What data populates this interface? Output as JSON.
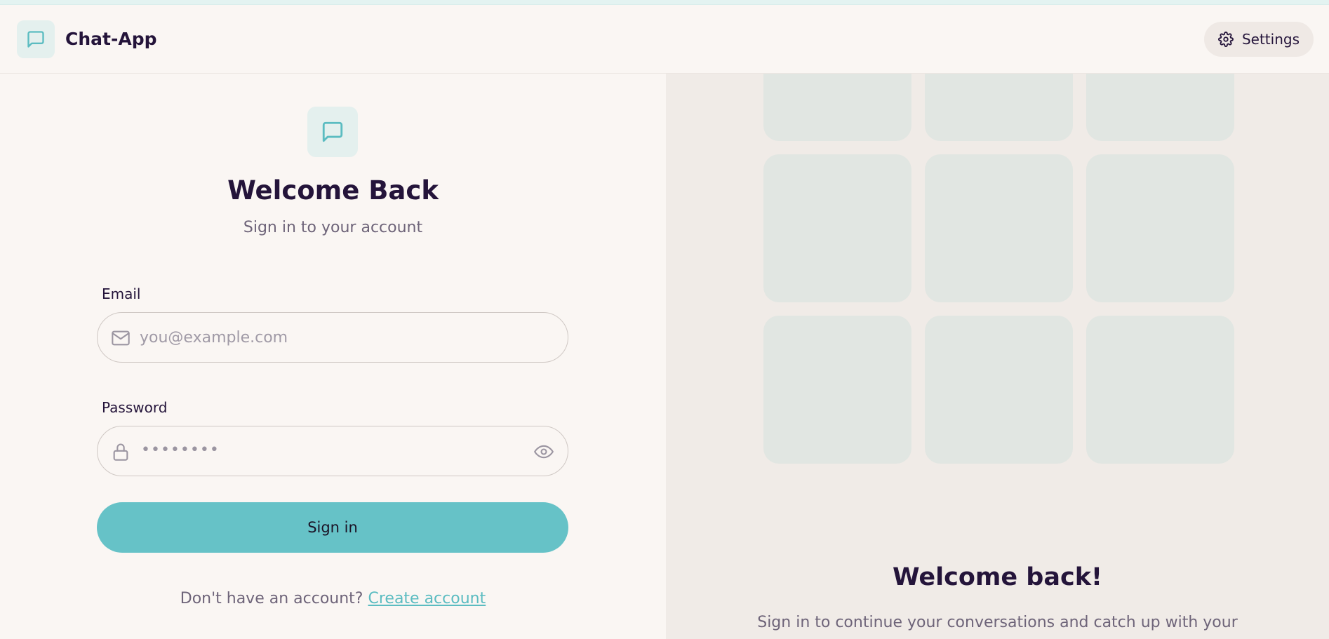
{
  "app": {
    "name": "Chat-App"
  },
  "header": {
    "settings_label": "Settings"
  },
  "login": {
    "title": "Welcome Back",
    "subtitle": "Sign in to your account",
    "email_label": "Email",
    "email_placeholder": "you@example.com",
    "password_label": "Password",
    "password_masked": "••••••••",
    "submit_label": "Sign in",
    "signup_prompt": "Don't have an account?",
    "signup_link": "Create account"
  },
  "promo": {
    "title": "Welcome back!",
    "text": "Sign in to continue your conversations and catch up with your",
    "tile_count": 9
  },
  "colors": {
    "accent": "#66c2c7",
    "heading": "#24143a",
    "muted": "#6e6479",
    "background": "#faf6f3",
    "panel": "#f0ebe7",
    "tile": "#e1e6e2"
  },
  "icons": {
    "brand": "message-square-icon",
    "settings": "gear-icon",
    "email": "mail-icon",
    "password": "lock-icon",
    "toggle_password": "eye-icon"
  }
}
